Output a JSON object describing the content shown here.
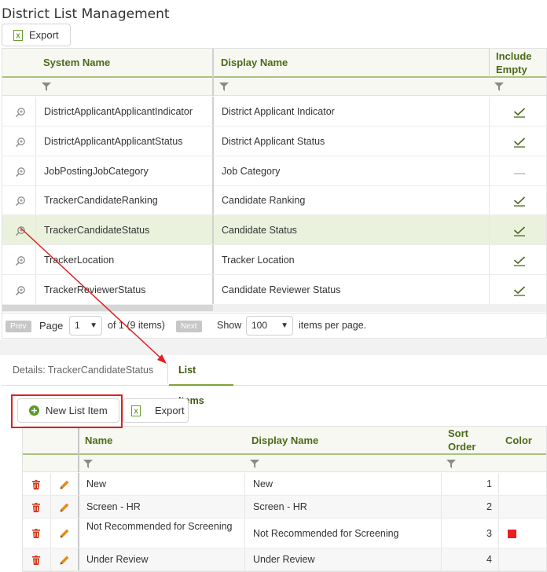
{
  "page": {
    "title": "District List Management"
  },
  "toolbar_top": {
    "export_label": "Export"
  },
  "grid_lists": {
    "columns": {
      "system_name": "System Name",
      "display_name": "Display Name",
      "include_empty_line1": "Include",
      "include_empty_line2": "Empty"
    },
    "rows": [
      {
        "system": "DistrictApplicantApplicantIndicator",
        "display": "District Applicant Indicator",
        "include_empty": true
      },
      {
        "system": "DistrictApplicantApplicantStatus",
        "display": "District Applicant Status",
        "include_empty": true
      },
      {
        "system": "JobPostingJobCategory",
        "display": "Job Category",
        "include_empty": false
      },
      {
        "system": "TrackerCandidateRanking",
        "display": "Candidate Ranking",
        "include_empty": true
      },
      {
        "system": "TrackerCandidateStatus",
        "display": "Candidate Status",
        "include_empty": true,
        "selected": true
      },
      {
        "system": "TrackerLocation",
        "display": "Tracker Location",
        "include_empty": true
      },
      {
        "system": "TrackerReviewerStatus",
        "display": "Candidate Reviewer Status",
        "include_empty": true
      }
    ],
    "pager": {
      "prev": "Prev",
      "page_label": "Page",
      "page_value": "1",
      "of_text": "of 1 (9 items)",
      "next": "Next",
      "show_label": "Show",
      "page_size": "100",
      "per_page_text": "items per page."
    }
  },
  "tabs": [
    {
      "label": "Details: TrackerCandidateStatus",
      "active": false
    },
    {
      "label": "List Items",
      "active": true
    }
  ],
  "toolbar_items": {
    "new_label": "New List Item",
    "export_label": "Export"
  },
  "grid_items": {
    "columns": {
      "name": "Name",
      "display_name": "Display Name",
      "sort_line1": "Sort",
      "sort_line2": "Order",
      "color": "Color"
    },
    "rows": [
      {
        "name": "New",
        "display": "New",
        "order": "1",
        "color": ""
      },
      {
        "name": "Screen - HR",
        "display": "Screen - HR",
        "order": "2",
        "color": ""
      },
      {
        "name": "Not Recommended for Screening",
        "display": "Not Recommended for Screening",
        "order": "3",
        "color": "#e82020"
      },
      {
        "name": "Under Review",
        "display": "Under Review",
        "order": "4",
        "color": ""
      }
    ]
  },
  "colors": {
    "accent": "#4c6a1a",
    "header_bg": "#f6f8f1",
    "selected_row": "#eaf2de",
    "annotation_red": "#e02020"
  }
}
